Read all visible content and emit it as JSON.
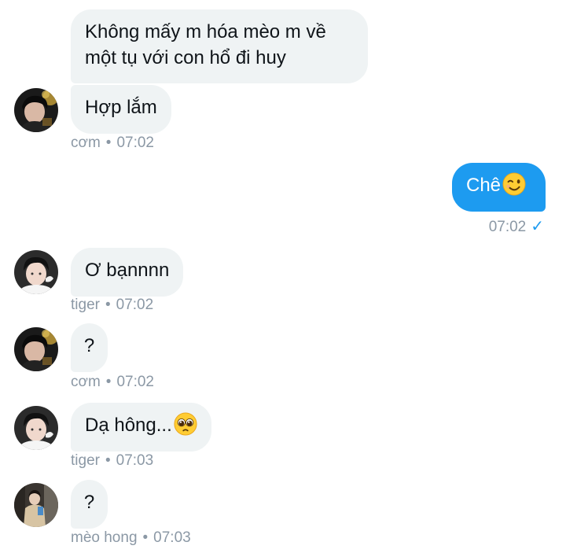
{
  "messages": [
    {
      "sender": "cơm",
      "lines": [
        "Không mấy m hóa mèo m về",
        "một tụ với con hổ đi huy"
      ]
    },
    {
      "sender": "cơm",
      "text": "Hợp lắm",
      "meta_name": "cơm",
      "time": "07:02"
    },
    {
      "sender": "me",
      "text": "Chê",
      "emoji": "winking-face-emoji",
      "time": "07:02",
      "status": "sent-check"
    },
    {
      "sender": "tiger",
      "text": "Ơ bạnnnn",
      "meta_name": "tiger",
      "time": "07:02"
    },
    {
      "sender": "cơm",
      "text": "?",
      "meta_name": "cơm",
      "time": "07:02"
    },
    {
      "sender": "tiger",
      "text": "Dạ hông...",
      "emoji": "pleading-face-emoji",
      "meta_name": "tiger",
      "time": "07:03"
    },
    {
      "sender": "mèo hong",
      "text": "?",
      "meta_name": "mèo hong",
      "time": "07:03"
    }
  ],
  "separator": "•",
  "check_glyph": "✓",
  "colors": {
    "incoming_bubble": "#eff3f4",
    "outgoing_bubble": "#1d9bf0",
    "meta_text": "#8b98a5",
    "text": "#0f1419"
  }
}
